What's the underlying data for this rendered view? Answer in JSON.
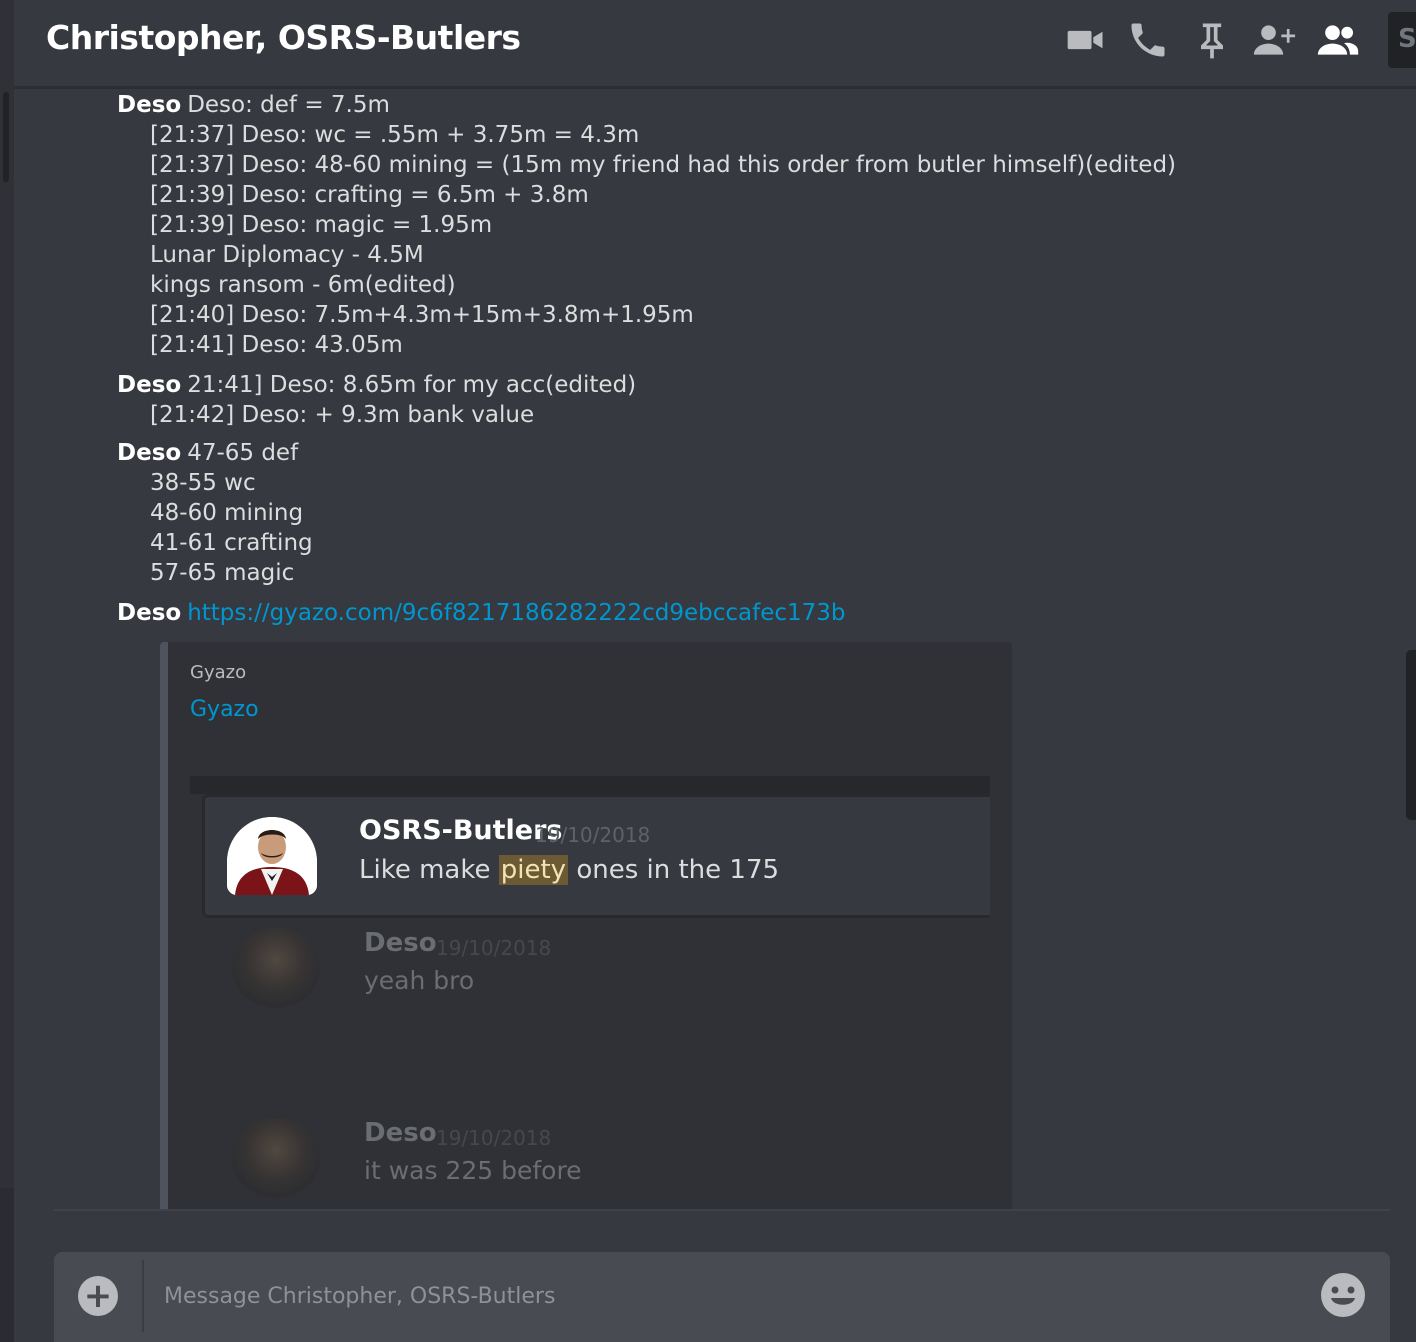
{
  "header": {
    "title": "Christopher, OSRS-Butlers",
    "search_stub": "S",
    "icons": [
      "video-call-icon",
      "voice-call-icon",
      "pin-icon",
      "add-friend-icon",
      "member-list-icon"
    ]
  },
  "messages": [
    {
      "author": "Deso",
      "first": "Deso: def = 7.5m",
      "lines": [
        "[21:37] Deso: wc = .55m + 3.75m = 4.3m",
        "[21:37] Deso: 48-60 mining = (15m my friend had this order from butler himself)(edited)",
        "[21:39] Deso: crafting = 6.5m + 3.8m",
        "[21:39] Deso: magic = 1.95m",
        "Lunar Diplomacy - 4.5M",
        "kings ransom - 6m(edited)",
        "[21:40] Deso: 7.5m+4.3m+15m+3.8m+1.95m",
        "[21:41] Deso: 43.05m"
      ]
    },
    {
      "author": "Deso",
      "first": "21:41] Deso: 8.65m for my acc(edited)",
      "lines": [
        "[21:42] Deso: + 9.3m bank value"
      ]
    },
    {
      "author": "Deso",
      "first": "47-65 def",
      "lines": [
        "38-55 wc",
        "48-60 mining",
        "41-61 crafting",
        "57-65 magic"
      ]
    },
    {
      "author": "Deso",
      "link": "https://gyazo.com/9c6f8217186282222cd9ebccafec173b"
    }
  ],
  "embed": {
    "provider": "Gyazo",
    "title": "Gyazo",
    "quoted": {
      "author": "OSRS-Butlers",
      "date": "19/10/2018",
      "text_before": "Like make ",
      "highlight": "piety",
      "text_after": " ones in the 175"
    },
    "faded": [
      {
        "author": "Deso",
        "date": "19/10/2018",
        "text": "yeah bro"
      },
      {
        "author": "Deso",
        "date": "19/10/2018",
        "text": "it was 225 before"
      }
    ]
  },
  "composer": {
    "placeholder": "Message Christopher, OSRS-Butlers",
    "plus": "+"
  },
  "colors": {
    "background": "#36393f",
    "link": "#0096cf",
    "highlight": "#6b5a33"
  }
}
